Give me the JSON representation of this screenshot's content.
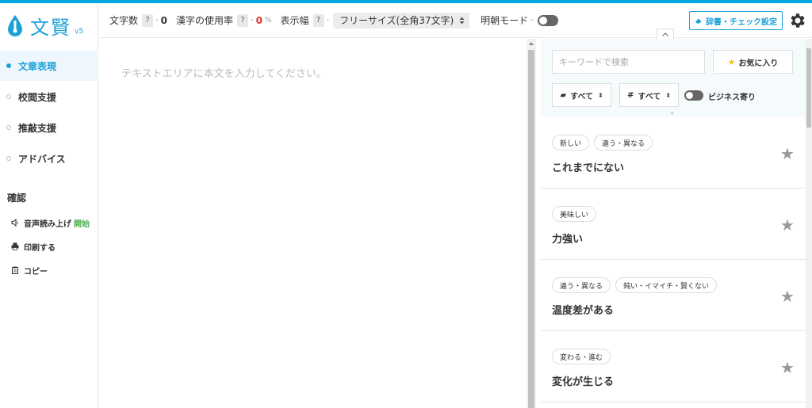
{
  "app": {
    "logo_text": "文賢",
    "version": "v5"
  },
  "sidebar": {
    "nav": [
      {
        "label": "文章表現",
        "active": true
      },
      {
        "label": "校閲支援",
        "active": false
      },
      {
        "label": "推敲支援",
        "active": false
      },
      {
        "label": "アドバイス",
        "active": false
      }
    ],
    "confirm_heading": "確認",
    "confirm_items": {
      "read_aloud": "音声読み上げ",
      "read_aloud_start": "開始",
      "print": "印刷する",
      "copy": "コピー"
    }
  },
  "header": {
    "char_count_label": "文字数",
    "char_count_help": "?",
    "char_count_value": "0",
    "kanji_rate_label": "漢字の使用率",
    "kanji_rate_help": "?",
    "kanji_rate_value": "0",
    "kanji_rate_unit": "%",
    "width_label": "表示幅",
    "width_help": "?",
    "width_value": "フリーサイズ(全角37文字)",
    "mincho_label": "明朝モード",
    "separator": "-",
    "dict_button": "辞書・チェック設定"
  },
  "editor": {
    "placeholder": "テキストエリアに本文を入力してください。"
  },
  "right_panel": {
    "keyword_placeholder": "キーワードで検索",
    "favorites_label": "お気に入り",
    "filter1_label": "すべて",
    "filter2_label": "すべて",
    "business_label": "ビジネス寄り",
    "results": [
      {
        "tags": [
          "新しい",
          "違う・異なる"
        ],
        "word": "これまでにない"
      },
      {
        "tags": [
          "美味しい"
        ],
        "word": "力強い"
      },
      {
        "tags": [
          "違う・異なる",
          "鈍い・イマイチ・賢くない"
        ],
        "word": "温度差がある"
      },
      {
        "tags": [
          "変わる・進む"
        ],
        "word": "変化が生じる"
      }
    ]
  },
  "colors": {
    "accent": "#1ba1d8",
    "top_line": "#00a6e0",
    "red_value": "#e53935",
    "start_green": "#4caf50"
  }
}
